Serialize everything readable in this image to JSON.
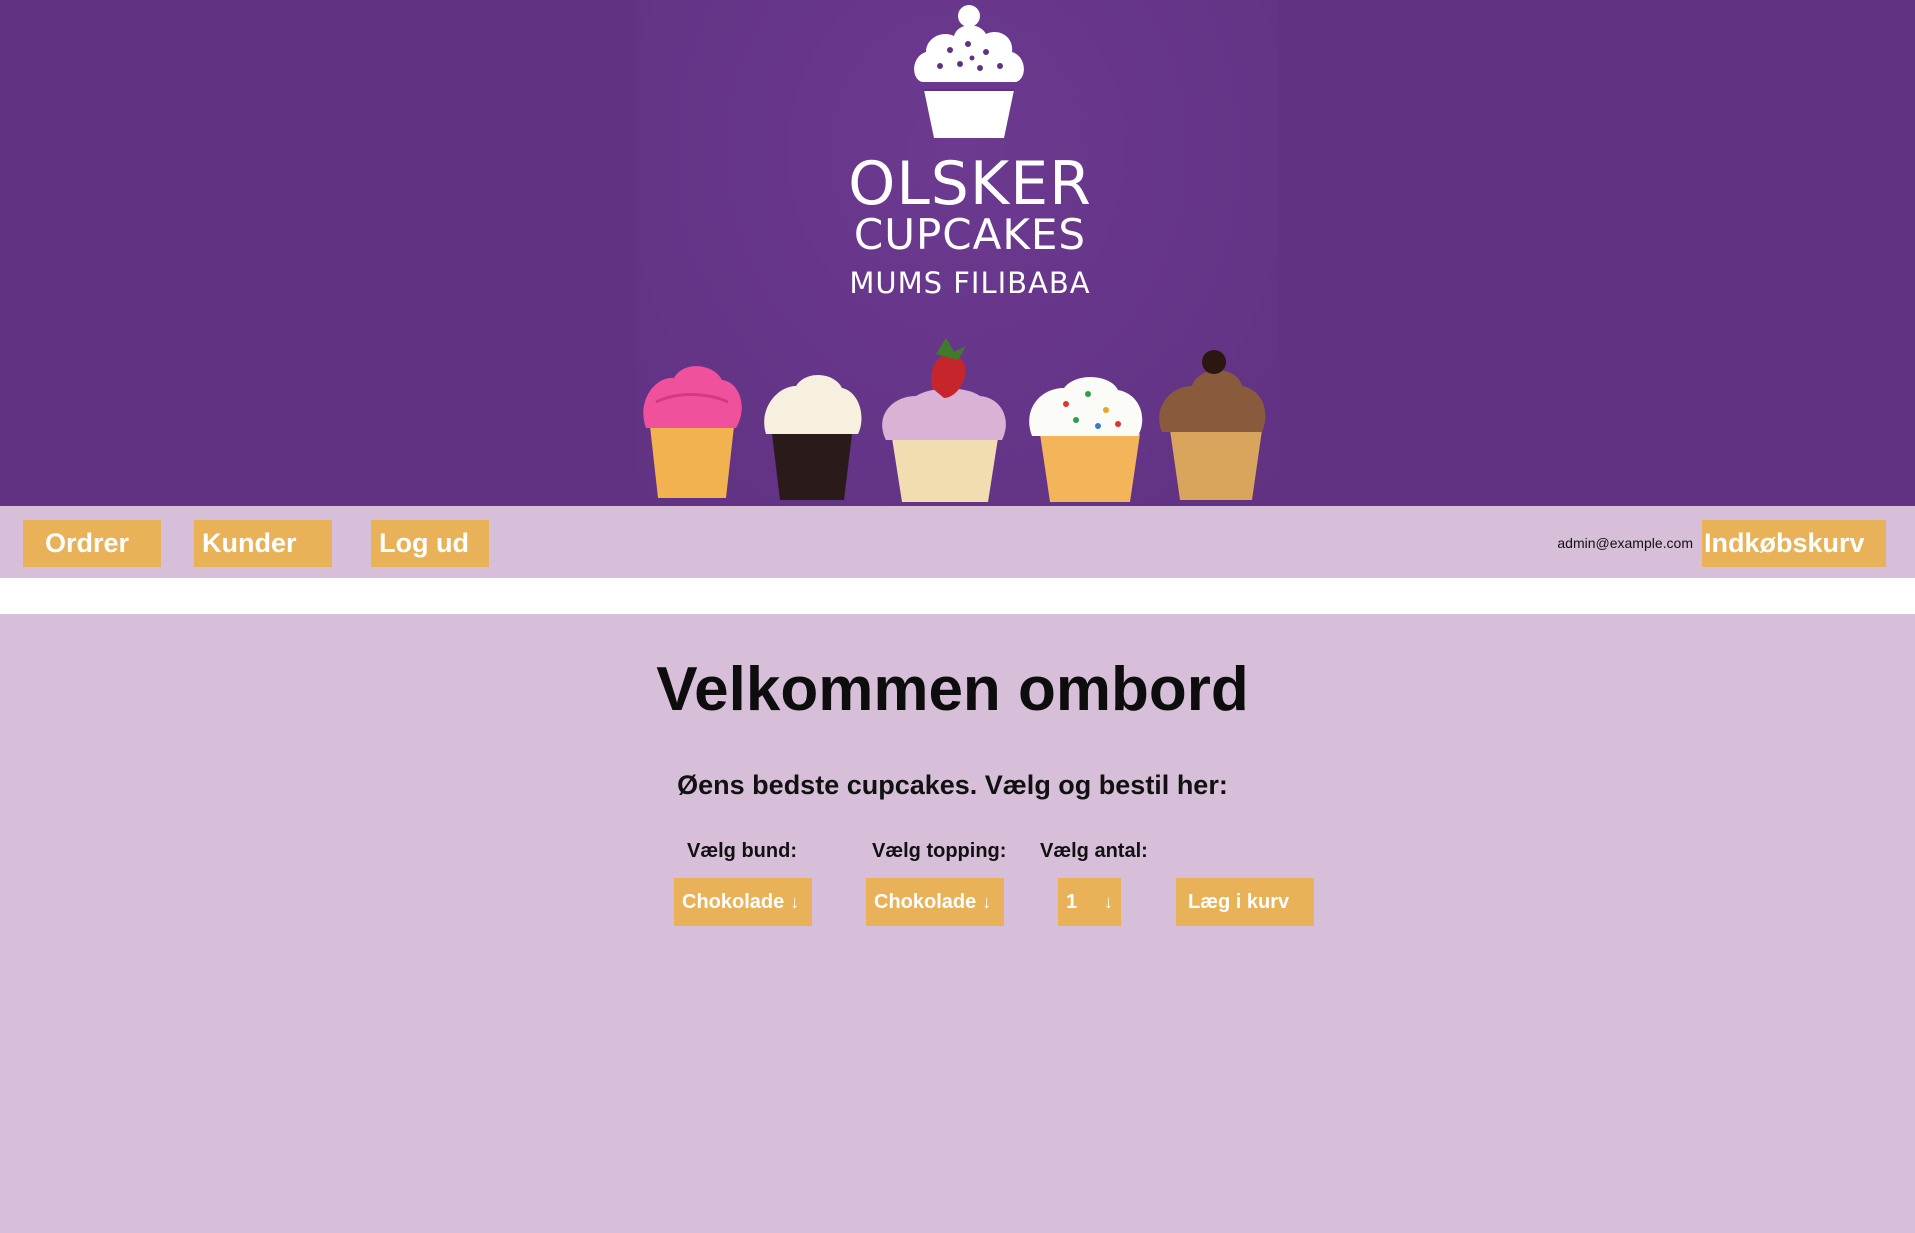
{
  "header": {
    "brand_line1": "OLSKER",
    "brand_line2": "CUPCAKES",
    "brand_tagline": "MUMS FILIBABA"
  },
  "nav": {
    "orders": "Ordrer",
    "customers": "Kunder",
    "logout": "Log ud",
    "user_email": "admin@example.com",
    "cart": "Indkøbskurv"
  },
  "main": {
    "title": "Velkommen ombord",
    "subtitle": "Øens bedste cupcakes. Vælg og bestil her:",
    "bottom_label": "Vælg bund:",
    "bottom_value": "Chokolade",
    "topping_label": "Vælg topping:",
    "topping_value": "Chokolade",
    "quantity_label": "Vælg antal:",
    "quantity_value": "1",
    "add_to_cart": "Læg i kurv",
    "dropdown_icon": "↓"
  },
  "colors": {
    "banner_purple": "#613282",
    "lilac_background": "#d7bfd9",
    "button_orange": "#e9b158"
  }
}
